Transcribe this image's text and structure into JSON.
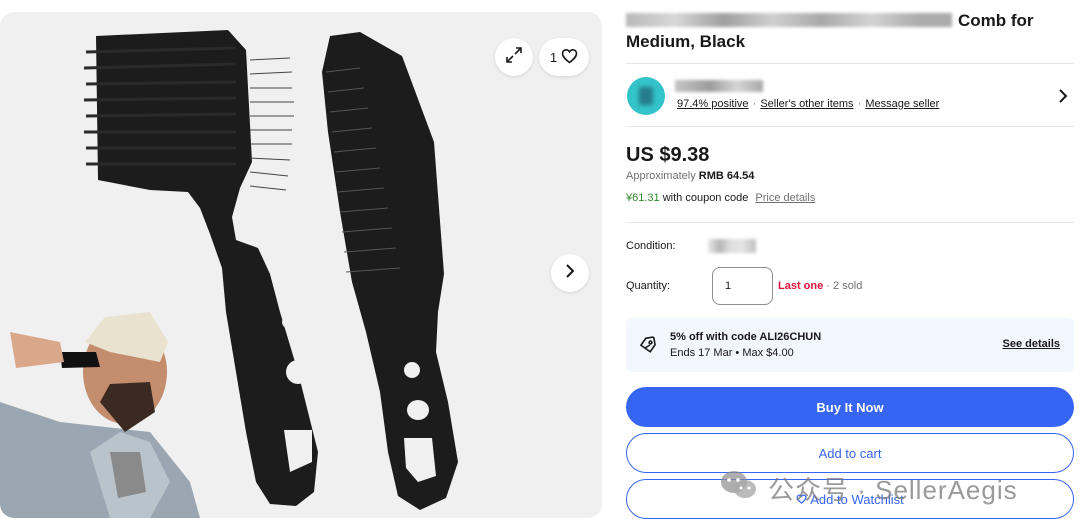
{
  "gallery": {
    "favorite_count": "1",
    "icons": {
      "expand": "expand-icon",
      "heart": "heart-icon",
      "next": "chevron-right-icon"
    }
  },
  "listing": {
    "title_visible": "Comb for",
    "title_line2": "Medium, Black"
  },
  "seller": {
    "positive": "97.4% positive",
    "other_items": "Seller's other items",
    "message": "Message seller",
    "separator": "·"
  },
  "pricing": {
    "price": "US $9.38",
    "approx_prefix": "Approximately",
    "approx_value": "RMB 64.54",
    "coupon_value": "¥61.31",
    "coupon_text": "with coupon code",
    "price_details": "Price details"
  },
  "condition": {
    "label": "Condition:"
  },
  "quantity": {
    "label": "Quantity:",
    "value": "1",
    "last_one": "Last one",
    "sold": "· 2 sold"
  },
  "promo": {
    "headline": "5% off with code ALI26CHUN",
    "terms": "Ends 17 Mar • Max $4.00",
    "see_details": "See details"
  },
  "actions": {
    "buy_now": "Buy It Now",
    "add_to_cart": "Add to cart",
    "add_to_watchlist": "Add to Watchlist"
  },
  "watermark": {
    "text": "公众号 · SellerAegis"
  },
  "colors": {
    "primary_blue": "#3665f3",
    "alert_red": "#e0103a",
    "coupon_green": "#2d8a2d",
    "promo_bg": "#f2f7fe"
  }
}
